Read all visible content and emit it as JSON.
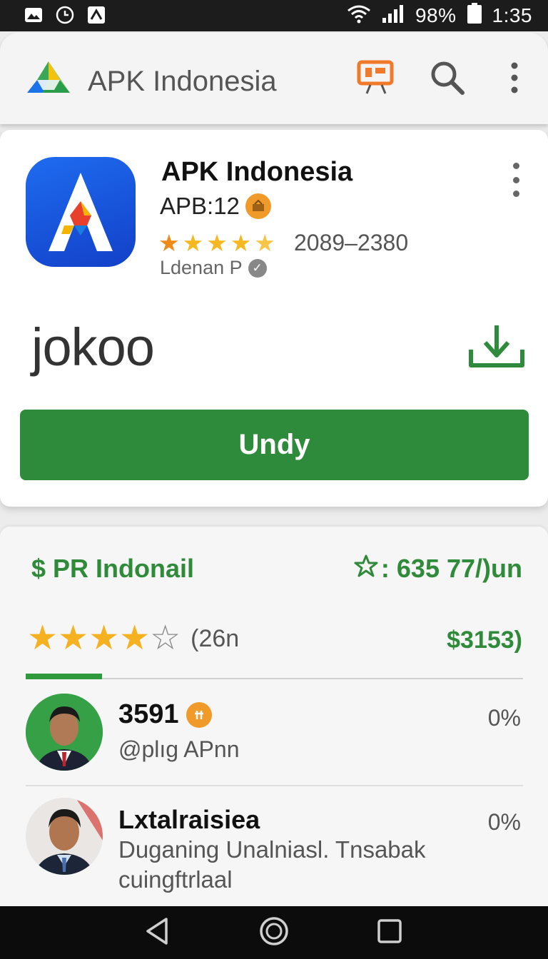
{
  "status_bar": {
    "left_icons": [
      "gallery-icon",
      "clock-icon",
      "notification-icon"
    ],
    "wifi_icon": "wifi-icon",
    "signal_icon": "signal-icon",
    "battery_percent": "98%",
    "battery_icon": "battery-icon",
    "time": "1:35"
  },
  "app_bar": {
    "title": "APK Indonesia",
    "logo_icon": "triangle-logo-icon",
    "cast_icon": "presentation-icon",
    "search_icon": "search-icon",
    "menu_icon": "more-vert-icon",
    "accent_color": "#f07a2a"
  },
  "app_card": {
    "name": "APK Indonesia",
    "version": "APB:12",
    "downloads": "2089–2380",
    "rating_stars": 5,
    "developer": "Ldenan P",
    "brand_word": "jokoo",
    "install_label": "Undy",
    "install_color": "#2e8b3c"
  },
  "reviews": {
    "price_title": "$ PR Indonail",
    "rating_head": ": 635 77/)un",
    "stars_filled": 4,
    "stars_total": 5,
    "count_text": "(26n",
    "price_right": "$3153)",
    "items": [
      {
        "name": "3591",
        "subtitle": "@plıg APnn",
        "percent": "0%"
      },
      {
        "name": "Lxtalraisiea",
        "body": "Duganing Unalniasl. Tnsabak cuingftrlaal",
        "percent": "0%"
      }
    ]
  },
  "nav_bar": {
    "back_icon": "back-triangle-icon",
    "home_icon": "home-circle-icon",
    "recents_icon": "recents-square-icon"
  }
}
